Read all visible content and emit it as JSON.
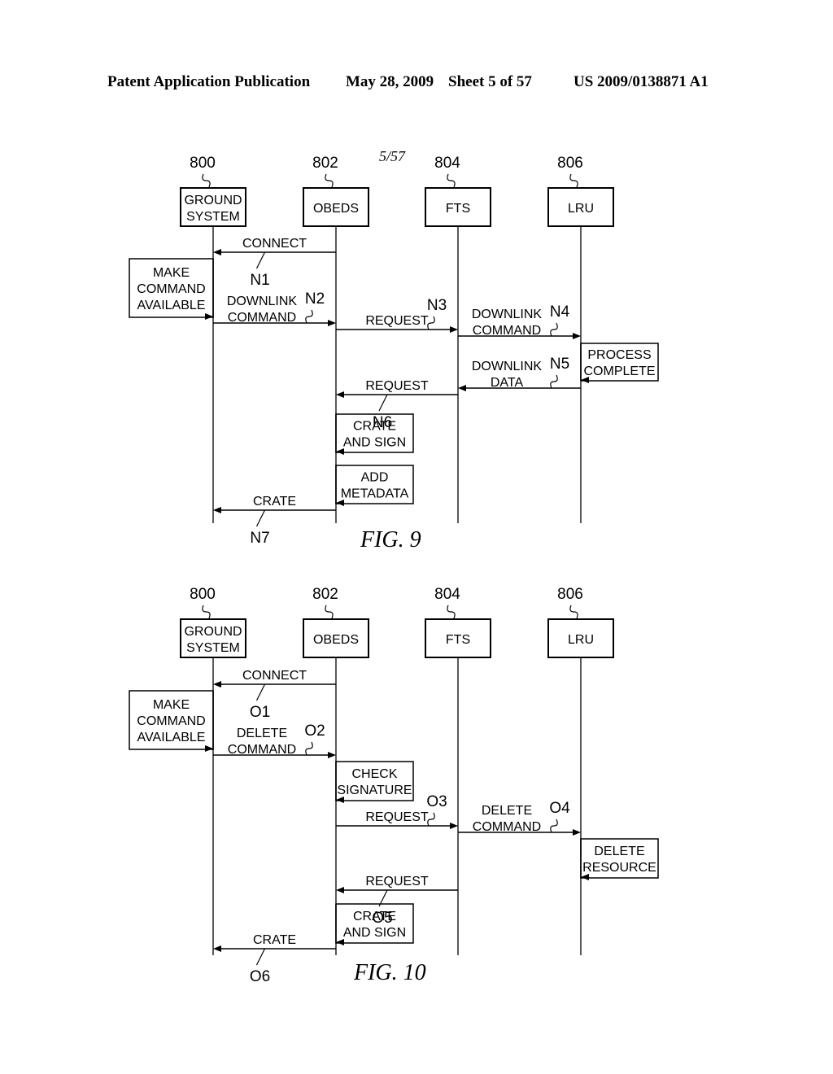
{
  "header": {
    "publication": "Patent Application Publication",
    "date": "May 28, 2009",
    "sheet": "Sheet 5 of 57",
    "number": "US 2009/0138871 A1"
  },
  "sheet_mark": "5/57",
  "figures": [
    {
      "caption": "FIG. 9",
      "actors": [
        {
          "ref": "800",
          "lines": [
            "GROUND",
            "SYSTEM"
          ]
        },
        {
          "ref": "802",
          "lines": [
            "OBEDS"
          ]
        },
        {
          "ref": "804",
          "lines": [
            "FTS"
          ]
        },
        {
          "ref": "806",
          "lines": [
            "LRU"
          ]
        }
      ],
      "messages": [
        {
          "from": 1,
          "to": 0,
          "lines": [
            "CONNECT"
          ],
          "ref": "N1",
          "ref_pos": "below"
        },
        {
          "from": 0,
          "to": 1,
          "lines": [
            "DOWNLINK",
            "COMMAND"
          ],
          "ref": "N2",
          "ref_pos": "above"
        },
        {
          "from": 1,
          "to": 2,
          "lines": [
            "REQUEST"
          ],
          "ref": "N3",
          "ref_pos": "above"
        },
        {
          "from": 2,
          "to": 3,
          "lines": [
            "DOWNLINK",
            "COMMAND"
          ],
          "ref": "N4",
          "ref_pos": "above"
        },
        {
          "from": 3,
          "to": 2,
          "lines": [
            "DOWNLINK",
            "DATA"
          ],
          "ref": "N5",
          "ref_pos": "above"
        },
        {
          "from": 2,
          "to": 1,
          "lines": [
            "REQUEST"
          ],
          "ref": "N6",
          "ref_pos": "below"
        },
        {
          "from": 1,
          "to": 0,
          "lines": [
            "CRATE"
          ],
          "ref": "N7",
          "ref_pos": "below"
        }
      ],
      "processes": [
        {
          "actor": 0,
          "side": "left",
          "lines": [
            "MAKE",
            "COMMAND",
            "AVAILABLE"
          ]
        },
        {
          "actor": 3,
          "side": "right",
          "lines": [
            "PROCESS",
            "COMPLETE"
          ]
        },
        {
          "actor": 1,
          "side": "right",
          "lines": [
            "CRATE",
            "AND SIGN"
          ]
        },
        {
          "actor": 1,
          "side": "right",
          "lines": [
            "ADD",
            "METADATA"
          ]
        }
      ]
    },
    {
      "caption": "FIG. 10",
      "actors": [
        {
          "ref": "800",
          "lines": [
            "GROUND",
            "SYSTEM"
          ]
        },
        {
          "ref": "802",
          "lines": [
            "OBEDS"
          ]
        },
        {
          "ref": "804",
          "lines": [
            "FTS"
          ]
        },
        {
          "ref": "806",
          "lines": [
            "LRU"
          ]
        }
      ],
      "messages": [
        {
          "from": 1,
          "to": 0,
          "lines": [
            "CONNECT"
          ],
          "ref": "O1",
          "ref_pos": "below"
        },
        {
          "from": 0,
          "to": 1,
          "lines": [
            "DELETE",
            "COMMAND"
          ],
          "ref": "O2",
          "ref_pos": "above"
        },
        {
          "from": 1,
          "to": 2,
          "lines": [
            "REQUEST"
          ],
          "ref": "O3",
          "ref_pos": "above"
        },
        {
          "from": 2,
          "to": 3,
          "lines": [
            "DELETE",
            "COMMAND"
          ],
          "ref": "O4",
          "ref_pos": "above"
        },
        {
          "from": 2,
          "to": 1,
          "lines": [
            "REQUEST"
          ],
          "ref": "O5",
          "ref_pos": "below"
        },
        {
          "from": 1,
          "to": 0,
          "lines": [
            "CRATE"
          ],
          "ref": "O6",
          "ref_pos": "below"
        }
      ],
      "processes": [
        {
          "actor": 0,
          "side": "left",
          "lines": [
            "MAKE",
            "COMMAND",
            "AVAILABLE"
          ]
        },
        {
          "actor": 1,
          "side": "right",
          "lines": [
            "CHECK",
            "SIGNATURE"
          ]
        },
        {
          "actor": 3,
          "side": "right",
          "lines": [
            "DELETE",
            "RESOURCE"
          ]
        },
        {
          "actor": 1,
          "side": "right",
          "lines": [
            "CRATE",
            "AND SIGN"
          ]
        }
      ]
    }
  ]
}
